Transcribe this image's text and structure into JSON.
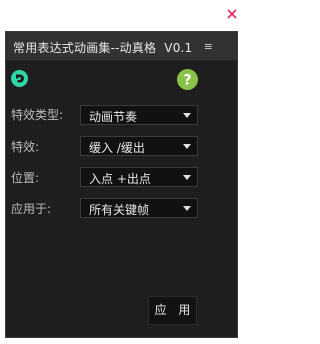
{
  "window": {
    "close_glyph": "×",
    "close_color": "#e0245e"
  },
  "panel": {
    "title": "常用表达式动画集--动真格",
    "version": "V0.1",
    "menu_glyph": "≡"
  },
  "icons": {
    "brand": "brand-logo-icon",
    "help": "help-icon",
    "brand_color": "#2fd6a8",
    "help_color": "#8bc34a"
  },
  "rows": [
    {
      "label": "特效类型:",
      "value": "动画节奏"
    },
    {
      "label": "特效:",
      "value": "缓入 /缓出"
    },
    {
      "label": "位置:",
      "value": "入点 +出点"
    },
    {
      "label": "应用于:",
      "value": "所有关键帧"
    }
  ],
  "apply_label": "应 用"
}
